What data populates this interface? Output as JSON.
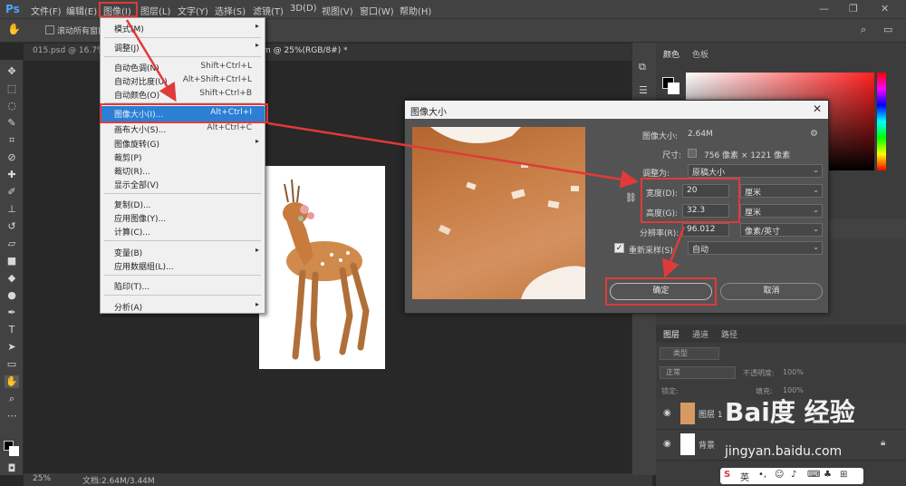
{
  "app": {
    "logo": "Ps"
  },
  "menubar": {
    "items": [
      "文件(F)",
      "编辑(E)",
      "图像(I)",
      "图层(L)",
      "文字(Y)",
      "选择(S)",
      "滤镜(T)",
      "3D(D)",
      "视图(V)",
      "窗口(W)",
      "帮助(H)"
    ],
    "window_buttons": [
      "—",
      "❐",
      "✕"
    ]
  },
  "options_bar": {
    "scroll_all_label": "滚动所有窗口"
  },
  "doc_tabs": [
    {
      "label": "015.psd @ 16.7%"
    },
    {
      "label": "m @ 25%(RGB/8#) *"
    }
  ],
  "image_menu": {
    "items": [
      {
        "label": "模式(M)",
        "shortcut": "",
        "submenu": true
      },
      {
        "label": "调整(J)",
        "shortcut": "",
        "submenu": true
      },
      {
        "label": "自动色调(N)",
        "shortcut": "Shift+Ctrl+L"
      },
      {
        "label": "自动对比度(U)",
        "shortcut": "Alt+Shift+Ctrl+L"
      },
      {
        "label": "自动颜色(O)",
        "shortcut": "Shift+Ctrl+B"
      },
      {
        "label": "图像大小(I)...",
        "shortcut": "Alt+Ctrl+I",
        "selected": true
      },
      {
        "label": "画布大小(S)...",
        "shortcut": "Alt+Ctrl+C"
      },
      {
        "label": "图像旋转(G)",
        "shortcut": "",
        "submenu": true
      },
      {
        "label": "裁剪(P)",
        "shortcut": ""
      },
      {
        "label": "裁切(R)...",
        "shortcut": ""
      },
      {
        "label": "显示全部(V)",
        "shortcut": ""
      },
      {
        "label": "复制(D)...",
        "shortcut": ""
      },
      {
        "label": "应用图像(Y)...",
        "shortcut": ""
      },
      {
        "label": "计算(C)...",
        "shortcut": ""
      },
      {
        "label": "变量(B)",
        "shortcut": "",
        "submenu": true
      },
      {
        "label": "应用数据组(L)...",
        "shortcut": ""
      },
      {
        "label": "陷印(T)...",
        "shortcut": ""
      },
      {
        "label": "分析(A)",
        "shortcut": "",
        "submenu": true
      }
    ]
  },
  "dialog": {
    "title": "图像大小",
    "image_size_label": "图像大小:",
    "image_size_value": "2.64M",
    "dimensions_label": "尺寸:",
    "dimensions_value": "756 像素 × 1221 像素",
    "fit_to_label": "调整为:",
    "fit_to_value": "原稿大小",
    "width_label": "宽度(D):",
    "width_value": "20",
    "width_unit": "厘米",
    "height_label": "高度(G):",
    "height_value": "32.3",
    "height_unit": "厘米",
    "resolution_label": "分辨率(R):",
    "resolution_value": "96.012",
    "resolution_unit": "像素/英寸",
    "resample_label": "重新采样(S):",
    "resample_value": "自动",
    "ok_label": "确定",
    "cancel_label": "取消"
  },
  "right_panel": {
    "color_tabs": [
      "颜色",
      "色板"
    ],
    "layer_tabs": [
      "图层",
      "通道",
      "路径"
    ],
    "kind_label": "类型",
    "blend_mode": "正常",
    "opacity_label": "不透明度:",
    "opacity_value": "100%",
    "lock_label": "锁定:",
    "fill_label": "填充:",
    "fill_value": "100%",
    "layers": [
      {
        "name": "图层 1"
      },
      {
        "name": "背景"
      }
    ]
  },
  "status_bar": {
    "zoom": "25%",
    "doc_info": "文档:2.64M/3.44M"
  },
  "watermark": {
    "logo_text": "Bai度 经验",
    "url": "jingyan.baidu.com"
  },
  "ime": {
    "label": "英"
  },
  "colors": {
    "highlight": "#e03a3a",
    "menu_selected": "#2b7fd4",
    "dialog_bg": "#535353"
  }
}
